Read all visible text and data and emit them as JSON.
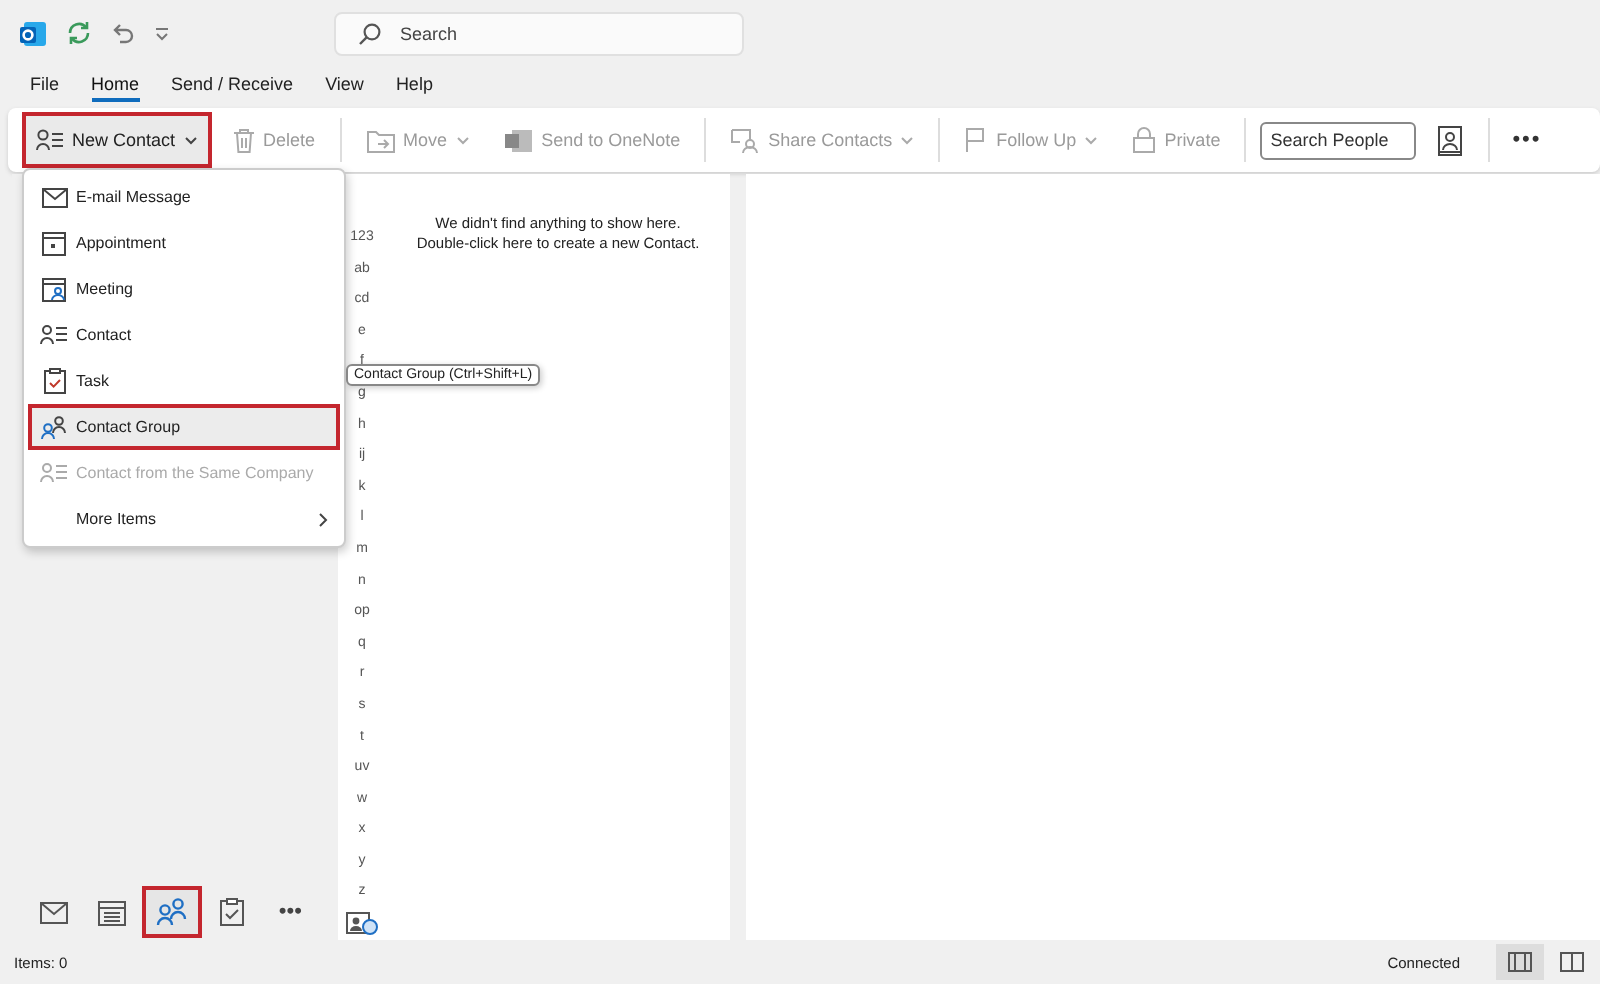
{
  "search": {
    "placeholder": "Search"
  },
  "tabs": [
    {
      "label": "File",
      "selected": false
    },
    {
      "label": "Home",
      "selected": true
    },
    {
      "label": "Send / Receive",
      "selected": false
    },
    {
      "label": "View",
      "selected": false
    },
    {
      "label": "Help",
      "selected": false
    }
  ],
  "ribbon": {
    "groups": [
      [
        {
          "kind": "button",
          "label": "New Contact",
          "caret": true,
          "disabled": false,
          "highlighted": true
        },
        {
          "kind": "button",
          "label": "Delete",
          "caret": false,
          "disabled": true,
          "highlighted": false
        }
      ],
      [
        {
          "kind": "button",
          "label": "Move",
          "caret": true,
          "disabled": true,
          "highlighted": false
        },
        {
          "kind": "button",
          "label": "Send to OneNote",
          "caret": false,
          "disabled": true,
          "highlighted": false
        }
      ],
      [
        {
          "kind": "button",
          "label": "Share Contacts",
          "caret": true,
          "disabled": true,
          "highlighted": false
        }
      ],
      [
        {
          "kind": "button",
          "label": "Follow Up",
          "caret": true,
          "disabled": true,
          "highlighted": false
        },
        {
          "kind": "button",
          "label": "Private",
          "caret": false,
          "disabled": true,
          "highlighted": false
        }
      ],
      [
        {
          "kind": "search",
          "placeholder": "Search People"
        },
        {
          "kind": "icon"
        }
      ],
      [
        {
          "kind": "more",
          "label": "•••"
        }
      ]
    ]
  },
  "menu": {
    "items": [
      {
        "label": "E-mail Message",
        "disabled": false,
        "selected": false,
        "submenu": false
      },
      {
        "label": "Appointment",
        "disabled": false,
        "selected": false,
        "submenu": false
      },
      {
        "label": "Meeting",
        "disabled": false,
        "selected": false,
        "submenu": false
      },
      {
        "label": "Contact",
        "disabled": false,
        "selected": false,
        "submenu": false
      },
      {
        "label": "Task",
        "disabled": false,
        "selected": false,
        "submenu": false
      },
      {
        "label": "Contact Group",
        "disabled": false,
        "selected": true,
        "submenu": false
      },
      {
        "label": "Contact from the Same Company",
        "disabled": true,
        "selected": false,
        "submenu": false
      },
      {
        "label": "More Items",
        "disabled": false,
        "selected": false,
        "submenu": true
      }
    ]
  },
  "tooltip": "Contact Group (Ctrl+Shift+L)",
  "letters": [
    "123",
    "ab",
    "cd",
    "e",
    "f",
    "g",
    "h",
    "ij",
    "k",
    "l",
    "m",
    "n",
    "op",
    "q",
    "r",
    "s",
    "t",
    "uv",
    "w",
    "x",
    "y",
    "z"
  ],
  "empty_message": [
    "We didn't find anything to show here.",
    "Double-click here to create a new Contact."
  ],
  "nav": {
    "items": [
      {
        "selected": false
      },
      {
        "selected": false
      },
      {
        "selected": true
      },
      {
        "selected": false
      },
      {
        "selected": false,
        "label": "•••"
      }
    ]
  },
  "status_bar": {
    "items": "Items: 0",
    "connection": "Connected",
    "views": [
      {
        "selected": true
      },
      {
        "selected": false
      }
    ]
  }
}
